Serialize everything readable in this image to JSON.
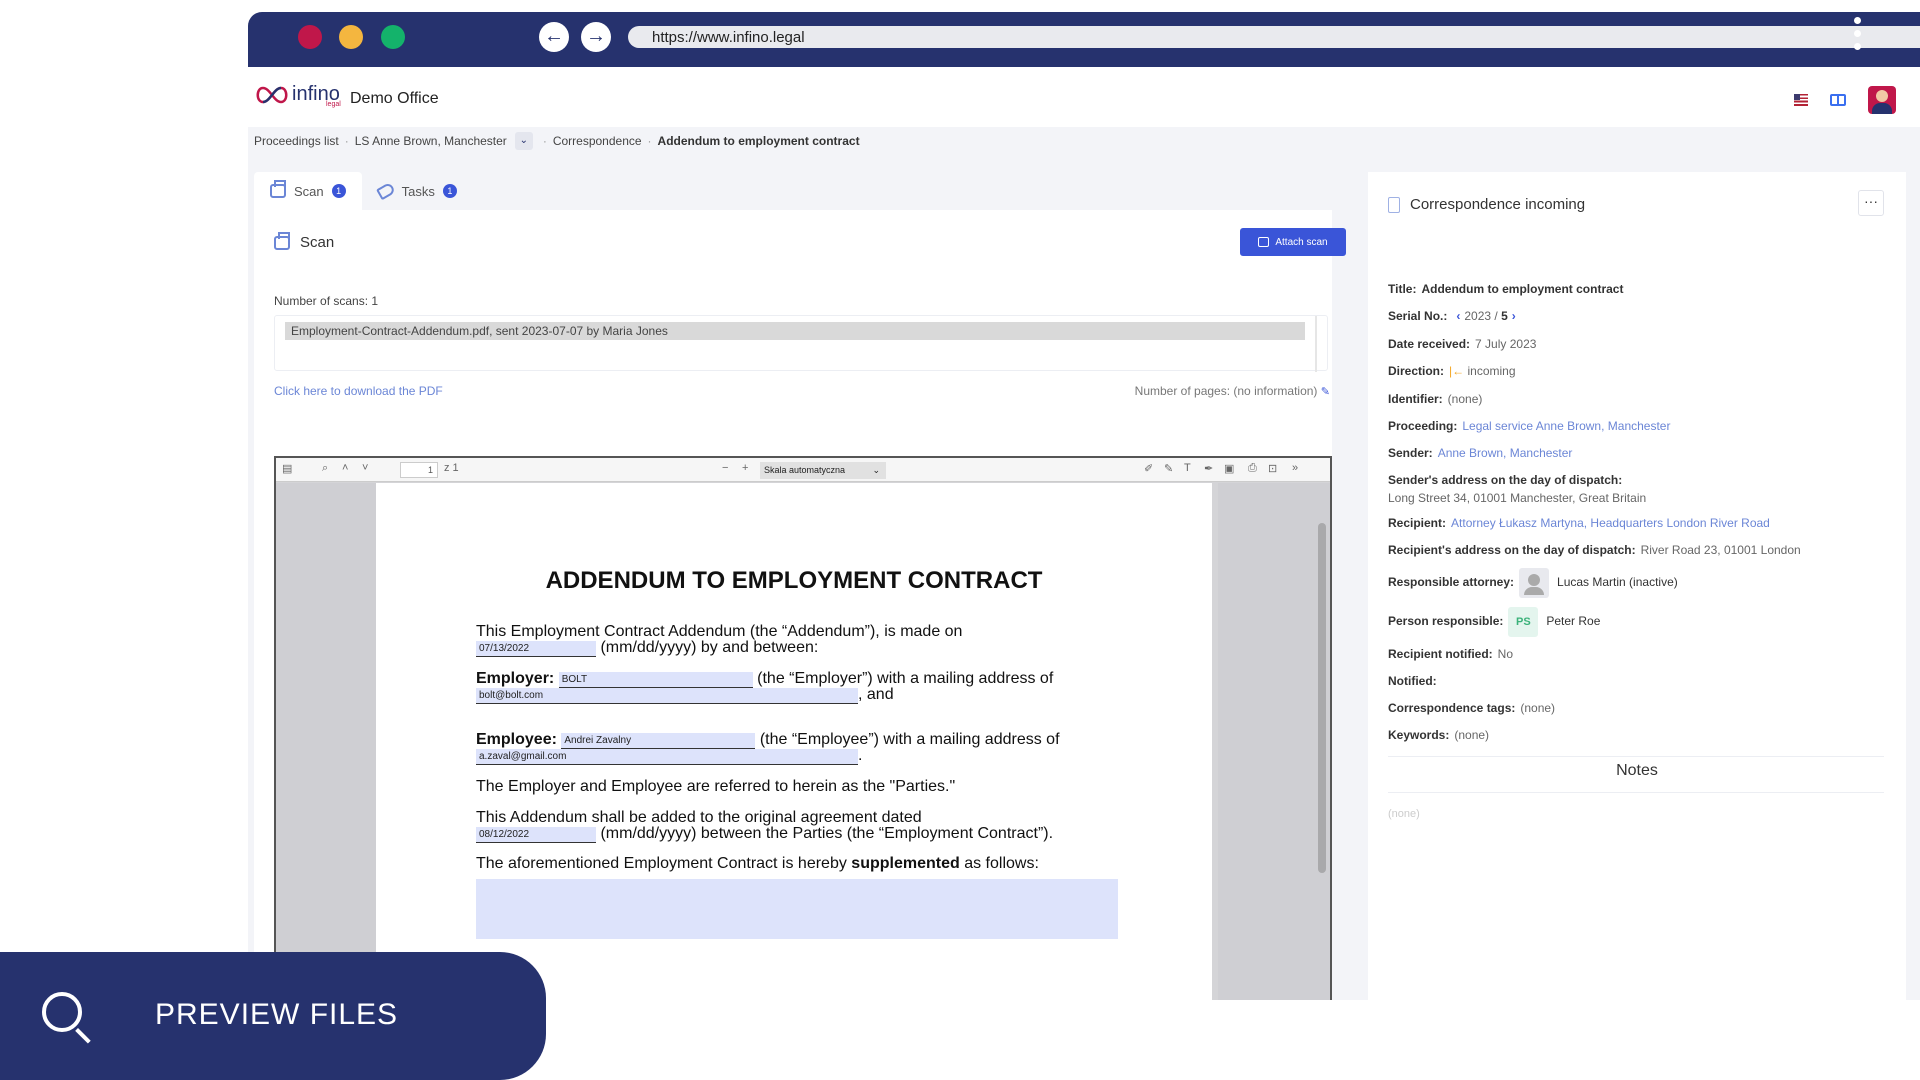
{
  "browser": {
    "url": "https://www.infino.legal"
  },
  "header": {
    "logo_text": "infino",
    "logo_sub": "legal",
    "office": "Demo Office"
  },
  "breadcrumb": {
    "items": [
      "Proceedings list",
      "LS Anne Brown, Manchester",
      "Correspondence",
      "Addendum to employment contract"
    ]
  },
  "tabs": [
    {
      "label": "Scan",
      "count": "1"
    },
    {
      "label": "Tasks",
      "count": "1"
    }
  ],
  "scan": {
    "title": "Scan",
    "attach_label": "Attach scan",
    "num_scans": "Number of scans: 1",
    "file": "Employment-Contract-Addendum.pdf, sent 2023-07-07 by Maria Jones",
    "download_link": "Click here to download the PDF",
    "num_pages": "Number of pages: (no information)"
  },
  "pdf": {
    "page_number": "1",
    "page_total": "z 1",
    "scale": "Skala automatyczna",
    "doc": {
      "title": "ADDENDUM TO EMPLOYMENT CONTRACT",
      "line1": "This Employment Contract Addendum (the “Addendum”), is made on",
      "date1": "07/13/2022",
      "line2_tail": "(mm/dd/yyyy) by and between:",
      "employer_label": "Employer:",
      "employer_value": "BOLT",
      "employer_tail": "(the “Employer”) with a mailing address of",
      "employer_email": "bolt@bolt.com",
      "employer_end": ", and",
      "employee_label": "Employee:",
      "employee_value": "Andrei Zavalny",
      "employee_tail": "(the “Employee”) with a mailing address of",
      "employee_email": "a.zaval@gmail.com",
      "employee_end": ".",
      "parties": "The Employer and Employee are referred to herein as the \"Parties.\"",
      "added_line": "This Addendum shall be added to the original agreement dated",
      "date2": "08/12/2022",
      "added_tail": "(mm/dd/yyyy) between the Parties (the “Employment Contract”).",
      "supp_start": "The aforementioned Employment Contract is hereby ",
      "supp_bold": "supplemented",
      "supp_end": " as follows:"
    }
  },
  "details": {
    "title": "Correspondence incoming",
    "more": "···",
    "title_label": "Title:",
    "title_value": "Addendum to employment contract",
    "serial_label": "Serial No.:",
    "serial_year": "2023 /",
    "serial_num": "5",
    "date_label": "Date received:",
    "date_value": "7 July 2023",
    "direction_label": "Direction:",
    "direction_value": "incoming",
    "identifier_label": "Identifier:",
    "identifier_value": "(none)",
    "proceeding_label": "Proceeding:",
    "proceeding_value": "Legal service Anne Brown, Manchester",
    "sender_label": "Sender:",
    "sender_value": "Anne Brown, Manchester",
    "sender_addr_label": "Sender's address on the day of dispatch:",
    "sender_addr_value": "Long Street 34, 01001 Manchester, Great Britain",
    "recipient_label": "Recipient:",
    "recipient_value": "Attorney Łukasz Martyna, Headquarters London River Road",
    "recipient_addr_label": "Recipient's address on the day of dispatch:",
    "recipient_addr_value": "River Road 23, 01001 London",
    "attorney_label": "Responsible attorney:",
    "attorney_value": "Lucas Martin (inactive)",
    "person_label": "Person responsible:",
    "person_initials": "PS",
    "person_value": "Peter Roe",
    "notified_rec_label": "Recipient notified:",
    "notified_rec_value": "No",
    "notified_label": "Notified:",
    "tags_label": "Correspondence tags:",
    "tags_value": "(none)",
    "keywords_label": "Keywords:",
    "keywords_value": "(none)",
    "notes_title": "Notes",
    "notes_value": "(none)"
  },
  "banner": {
    "label": "PREVIEW FILES"
  },
  "colors": {
    "navy": "#26326e",
    "accent": "#3a55d8",
    "link": "#6b86d6",
    "traffic_red": "#c0174a",
    "traffic_yellow": "#f4b63f",
    "traffic_green": "#14b36b"
  }
}
